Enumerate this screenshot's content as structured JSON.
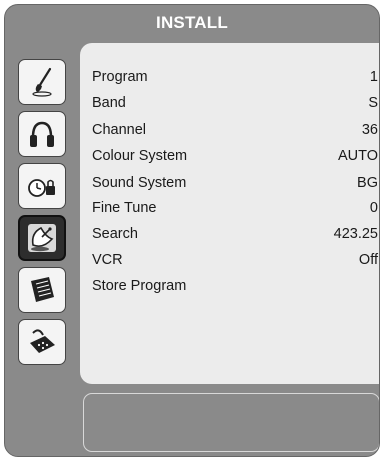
{
  "header": {
    "title": "INSTALL"
  },
  "sidebar": {
    "items": [
      {
        "name": "picture",
        "icon": "brush-icon",
        "selected": false
      },
      {
        "name": "sound",
        "icon": "headphones-icon",
        "selected": false
      },
      {
        "name": "feature",
        "icon": "clock-lock-icon",
        "selected": false
      },
      {
        "name": "install",
        "icon": "satellite-dish-icon",
        "selected": true
      },
      {
        "name": "source",
        "icon": "notebook-icon",
        "selected": false
      },
      {
        "name": "connection",
        "icon": "scart-connector-icon",
        "selected": false
      }
    ]
  },
  "menu": {
    "items": [
      {
        "label": "Program",
        "value": "1"
      },
      {
        "label": "Band",
        "value": "S"
      },
      {
        "label": "Channel",
        "value": "36"
      },
      {
        "label": "Colour System",
        "value": "AUTO"
      },
      {
        "label": "Sound System",
        "value": "BG"
      },
      {
        "label": "Fine Tune",
        "value": "0"
      },
      {
        "label": "Search",
        "value": "423.25"
      },
      {
        "label": "VCR",
        "value": "Off"
      },
      {
        "label": "Store Program",
        "value": ""
      }
    ]
  },
  "colors": {
    "frame": "#8a8a8a",
    "panel": "#ececec",
    "selected_icon": "#2d2d2d",
    "header_text": "#ffffff"
  }
}
